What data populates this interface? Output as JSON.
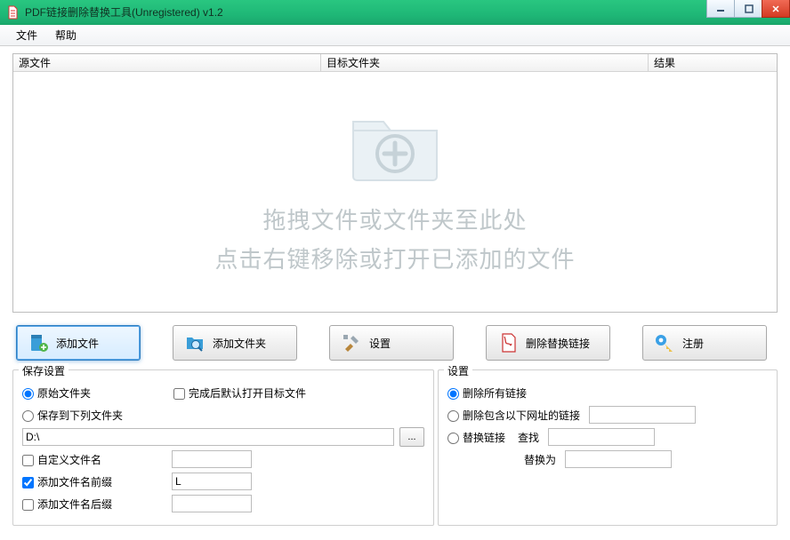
{
  "window": {
    "title": "PDF链接删除替换工具(Unregistered) v1.2"
  },
  "menu": {
    "file": "文件",
    "help": "帮助"
  },
  "columns": {
    "source": "源文件",
    "target": "目标文件夹",
    "result": "结果"
  },
  "dropzone": {
    "line1": "拖拽文件或文件夹至此处",
    "line2": "点击右键移除或打开已添加的文件"
  },
  "toolbar": {
    "add_file": "添加文件",
    "add_folder": "添加文件夹",
    "settings": "设置",
    "delete_replace": "删除替换链接",
    "register": "注册"
  },
  "save": {
    "legend": "保存设置",
    "original_folder": "原始文件夹",
    "save_to_folder": "保存到下列文件夹",
    "path_value": "D:\\",
    "open_after": "完成后默认打开目标文件",
    "custom_name": "自定义文件名",
    "add_prefix": "添加文件名前缀",
    "prefix_value": "L",
    "add_suffix": "添加文件名后缀",
    "custom_name_value": "",
    "suffix_value": ""
  },
  "link": {
    "legend": "设置",
    "delete_all": "删除所有链接",
    "delete_containing": "删除包含以下网址的链接",
    "delete_value": "",
    "replace_link": "替换链接",
    "find_label": "查找",
    "find_value": "",
    "replace_label": "替换为",
    "replace_value": ""
  },
  "browse_label": "..."
}
